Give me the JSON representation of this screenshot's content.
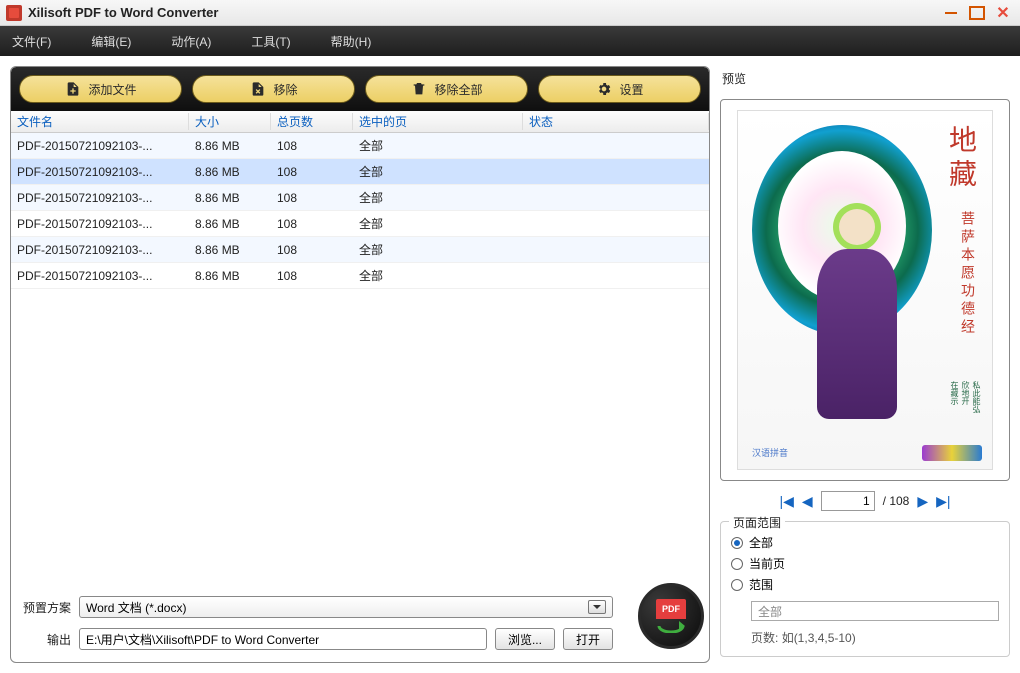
{
  "app": {
    "title": "Xilisoft PDF to Word Converter"
  },
  "menu": {
    "file": "文件(F)",
    "edit": "编辑(E)",
    "action": "动作(A)",
    "tool": "工具(T)",
    "help": "帮助(H)"
  },
  "toolbar": {
    "add": "添加文件",
    "remove": "移除",
    "remove_all": "移除全部",
    "settings": "设置"
  },
  "table": {
    "headers": {
      "name": "文件名",
      "size": "大小",
      "pages": "总页数",
      "selected": "选中的页",
      "status": "状态"
    },
    "rows": [
      {
        "name": "PDF-20150721092103-...",
        "size": "8.86 MB",
        "pages": "108",
        "selected": "全部",
        "status": ""
      },
      {
        "name": "PDF-20150721092103-...",
        "size": "8.86 MB",
        "pages": "108",
        "selected": "全部",
        "status": ""
      },
      {
        "name": "PDF-20150721092103-...",
        "size": "8.86 MB",
        "pages": "108",
        "selected": "全部",
        "status": ""
      },
      {
        "name": "PDF-20150721092103-...",
        "size": "8.86 MB",
        "pages": "108",
        "selected": "全部",
        "status": ""
      },
      {
        "name": "PDF-20150721092103-...",
        "size": "8.86 MB",
        "pages": "108",
        "selected": "全部",
        "status": ""
      },
      {
        "name": "PDF-20150721092103-...",
        "size": "8.86 MB",
        "pages": "108",
        "selected": "全部",
        "status": ""
      }
    ],
    "selected_index": 1
  },
  "preset": {
    "label": "预置方案",
    "value": "Word 文档 (*.docx)"
  },
  "output": {
    "label": "输出",
    "path": "E:\\用户\\文档\\Xilisoft\\PDF to Word Converter",
    "browse": "浏览...",
    "open": "打开"
  },
  "convert": {
    "badge": "PDF"
  },
  "preview": {
    "label": "预览",
    "title_vertical": "地藏",
    "subtitle_vertical": "菩萨本愿功德经",
    "stamp": "汉语拼音",
    "current_page": "1",
    "total_pages": "108",
    "separator": "/"
  },
  "range": {
    "group": "页面范围",
    "all": "全部",
    "current": "当前页",
    "custom": "范围",
    "custom_placeholder": "全部",
    "hint_label": "页数:",
    "hint_example": "如(1,3,4,5-10)",
    "selected": "all"
  }
}
